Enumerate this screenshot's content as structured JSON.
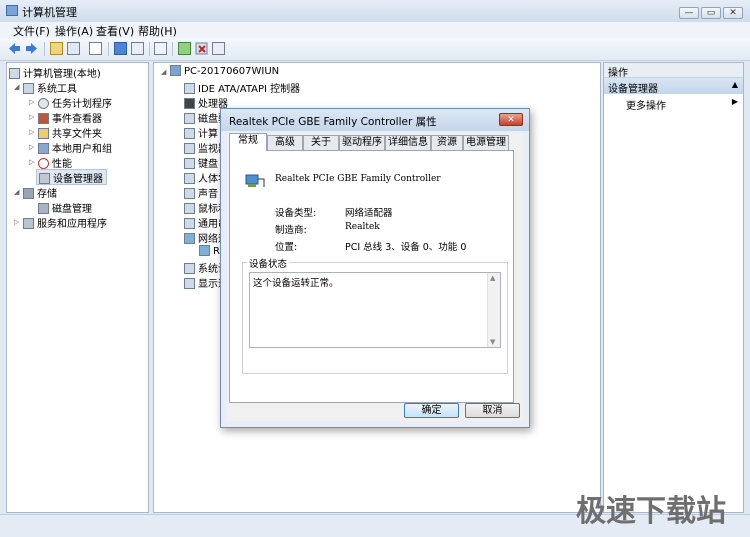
{
  "window": {
    "title": "计算机管理"
  },
  "menu": [
    "文件(F)",
    "操作(A)",
    "查看(V)",
    "帮助(H)"
  ],
  "toolbar_icons": [
    "back-icon",
    "forward-icon",
    "up-folder-icon",
    "show-tree-icon",
    "export-icon",
    "help-icon",
    "view-icon",
    "properties-icon",
    "update-driver-icon",
    "uninstall-icon",
    "disable-icon",
    "scan-hardware-icon"
  ],
  "left_tree": [
    {
      "label": "计算机管理(本地)",
      "level": 0
    },
    {
      "label": "系统工具",
      "level": 1
    },
    {
      "label": "任务计划程序",
      "level": 2
    },
    {
      "label": "事件查看器",
      "level": 2
    },
    {
      "label": "共享文件夹",
      "level": 2
    },
    {
      "label": "本地用户和组",
      "level": 2
    },
    {
      "label": "性能",
      "level": 2
    },
    {
      "label": "设备管理器",
      "level": 2
    },
    {
      "label": "存储",
      "level": 1
    },
    {
      "label": "磁盘管理",
      "level": 2
    },
    {
      "label": "服务和应用程序",
      "level": 1
    }
  ],
  "device_tree": {
    "root": "PC-20170607WIUN",
    "items": [
      "IDE ATA/ATAPI 控制器",
      "处理器",
      "磁盘驱",
      "计算",
      "监视器",
      "键盘",
      "人体学",
      "声音",
      "鼠标和",
      "通用串",
      "网络适",
      "R",
      "系统设",
      "显示适"
    ]
  },
  "actions": {
    "header": "操作",
    "section": "设备管理器",
    "more": "更多操作"
  },
  "dialog": {
    "title": "Realtek PCIe GBE Family Controller 属性",
    "close": "✕",
    "tabs": [
      "常规",
      "高级",
      "关于",
      "驱动程序",
      "详细信息",
      "资源",
      "电源管理"
    ],
    "device_name": "Realtek PCIe GBE Family Controller",
    "props": [
      {
        "label": "设备类型:",
        "value": "网络适配器"
      },
      {
        "label": "制造商:",
        "value": "Realtek"
      },
      {
        "label": "位置:",
        "value": "PCI 总线 3、设备 0、功能 0"
      }
    ],
    "status_label": "设备状态",
    "status_text": "这个设备运转正常。",
    "ok": "确定",
    "cancel": "取消"
  },
  "watermark": "极速下载站"
}
